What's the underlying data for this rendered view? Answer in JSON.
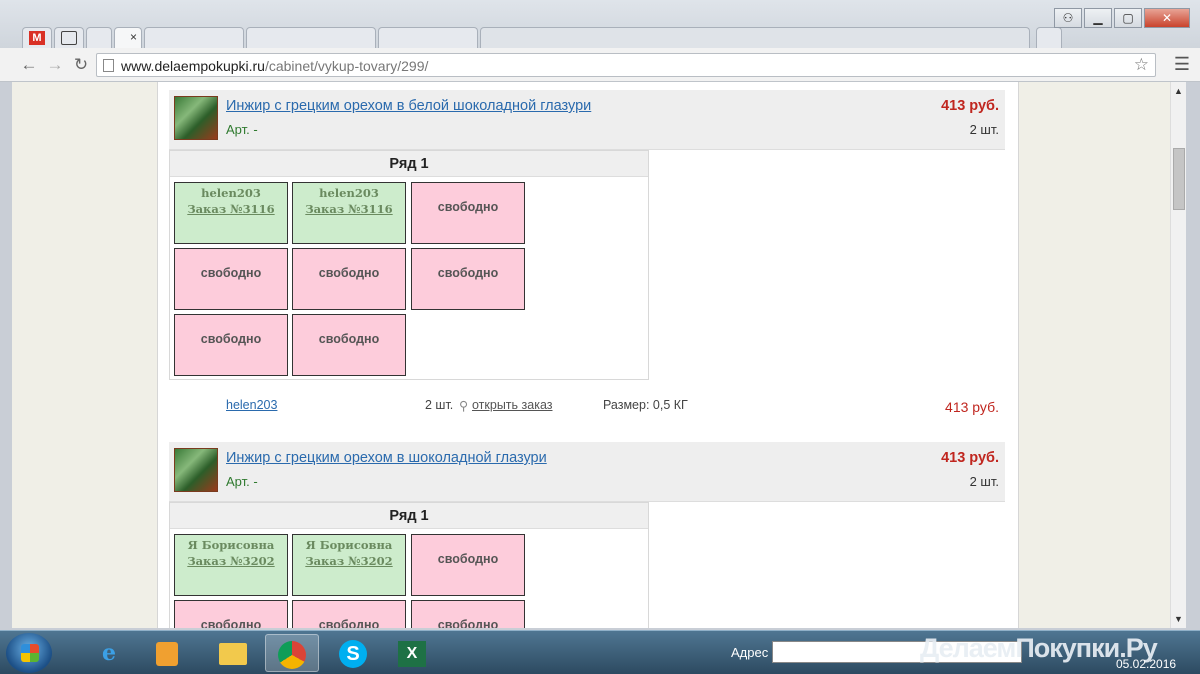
{
  "browser": {
    "url_host": "www.delaempokupki.ru",
    "url_path": "/cabinet/vykup-tovary/299/",
    "tab_gmail_badge": "M",
    "tab_close": "×"
  },
  "products": [
    {
      "title": "Инжир с грецким орехом в белой шоколадной глазури",
      "art": "Арт. -",
      "price": "413 руб.",
      "qty": "2 шт.",
      "row_label": "Ряд 1",
      "cells": [
        {
          "status": "taken",
          "user": "helen203",
          "order": "Заказ №3116"
        },
        {
          "status": "taken",
          "user": "helen203",
          "order": "Заказ №3116"
        },
        {
          "status": "free",
          "text": "свободно"
        },
        {
          "status": "free",
          "text": "свободно"
        },
        {
          "status": "free",
          "text": "свободно"
        },
        {
          "status": "free",
          "text": "свободно"
        },
        {
          "status": "free",
          "text": "свободно"
        },
        {
          "status": "free",
          "text": "свободно"
        }
      ],
      "order_line": {
        "user": "helen203",
        "qty": "2 шт.",
        "open_link": "открыть заказ",
        "size": "Размер: 0,5 КГ",
        "price": "413 руб."
      }
    },
    {
      "title": "Инжир с грецким орехом в шоколадной глазури",
      "art": "Арт. -",
      "price": "413 руб.",
      "qty": "2 шт.",
      "row_label": "Ряд 1",
      "cells": [
        {
          "status": "taken",
          "user": "Я Борисовна",
          "order": "Заказ №3202"
        },
        {
          "status": "taken",
          "user": "Я Борисовна",
          "order": "Заказ №3202"
        },
        {
          "status": "free",
          "text": "свободно"
        },
        {
          "status": "free",
          "text": "свободно"
        },
        {
          "status": "free",
          "text": "свободно"
        },
        {
          "status": "free",
          "text": "свободно"
        }
      ]
    }
  ],
  "taskbar": {
    "address_label": "Адрес",
    "brand": "ДелаемПокупки.Ру",
    "date": "05.02.2016"
  },
  "colors": {
    "taken_cell": "#cdeccc",
    "free_cell": "#fdccdb",
    "price": "#c0261f",
    "link": "#2a6aad"
  }
}
